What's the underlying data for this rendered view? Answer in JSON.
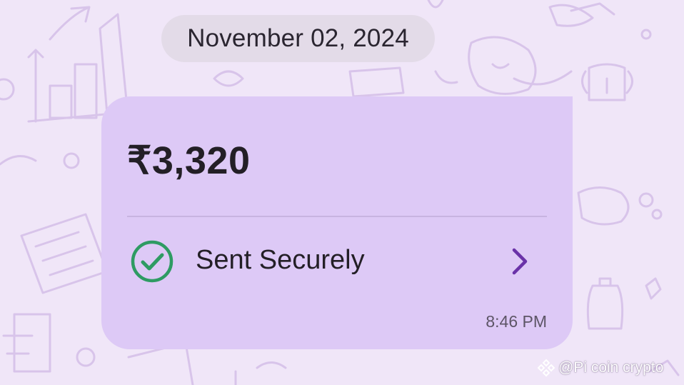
{
  "chat": {
    "date_label": "November 02, 2024"
  },
  "payment": {
    "amount": "₹3,320",
    "status_label": "Sent Securely",
    "status_icon": "check-circle-icon",
    "detail_icon": "chevron-right-icon",
    "time": "8:46 PM"
  },
  "watermark": {
    "text": "@Pi coin crypto"
  },
  "colors": {
    "background": "#f0e6f8",
    "bubble": "#ddc9f6",
    "date_pill": "#e3dbe8",
    "success_green": "#2e9b63",
    "chevron_purple": "#6a32a8",
    "text_dark": "#231f26"
  }
}
